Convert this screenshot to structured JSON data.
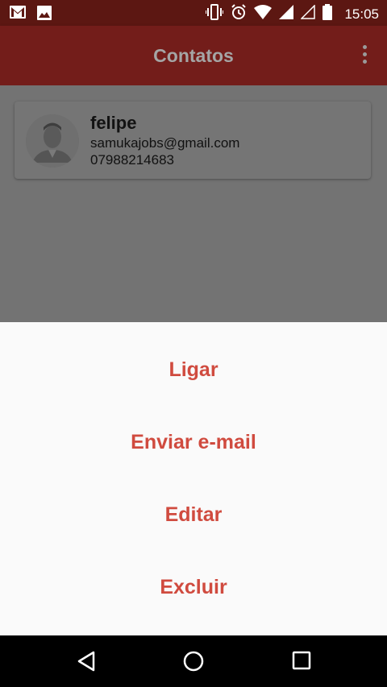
{
  "status_bar": {
    "time": "15:05",
    "icons": [
      "gmail-icon",
      "image-icon",
      "vibrate-icon",
      "alarm-icon",
      "wifi-icon",
      "signal-icon",
      "signal-empty-icon",
      "battery-icon"
    ]
  },
  "app_bar": {
    "title": "Contatos",
    "menu_icon": "more-vert-icon"
  },
  "contacts": [
    {
      "name": "felipe",
      "email": "samukajobs@gmail.com",
      "phone": "07988214683"
    }
  ],
  "bottom_sheet": {
    "options": [
      "Ligar",
      "Enviar e-mail",
      "Editar",
      "Excluir"
    ]
  },
  "nav_bar": {
    "buttons": [
      "back-icon",
      "home-icon",
      "recents-icon"
    ]
  },
  "colors": {
    "status_bar": "#5c1712",
    "app_bar": "#731d1a",
    "accent_text": "#d04b3f",
    "scrim": "#737373",
    "sheet": "#fafafa"
  }
}
